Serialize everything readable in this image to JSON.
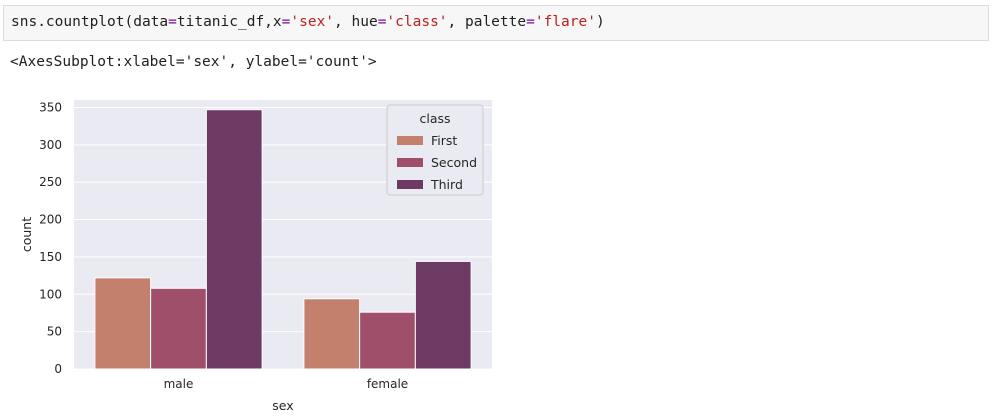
{
  "cell": {
    "code": {
      "t1": "sns.countplot(data",
      "t2": "=",
      "t3": "titanic_df,x",
      "t4": "=",
      "t5": "'sex'",
      "t6": ", hue",
      "t7": "=",
      "t8": "'class'",
      "t9": ", palette",
      "t10": "=",
      "t11": "'flare'",
      "t12": ")"
    },
    "output_text": "<AxesSubplot:xlabel='sex', ylabel='count'>"
  },
  "colors": {
    "plot_background": "#eaeaf2",
    "grid": "#ffffff",
    "text": "#262626"
  },
  "chart_data": {
    "type": "bar",
    "categories": [
      "male",
      "female"
    ],
    "series": [
      {
        "name": "First",
        "values": [
          122,
          94
        ],
        "color": "#c3806d"
      },
      {
        "name": "Second",
        "values": [
          108,
          76
        ],
        "color": "#9f4f69"
      },
      {
        "name": "Third",
        "values": [
          347,
          144
        ],
        "color": "#6c3a62"
      }
    ],
    "xlabel": "sex",
    "ylabel": "count",
    "ylim": [
      0,
      360
    ],
    "yticks": [
      0,
      50,
      100,
      150,
      200,
      250,
      300,
      350
    ],
    "grid": true,
    "legend": {
      "title": "class",
      "placement": "top-right"
    }
  }
}
